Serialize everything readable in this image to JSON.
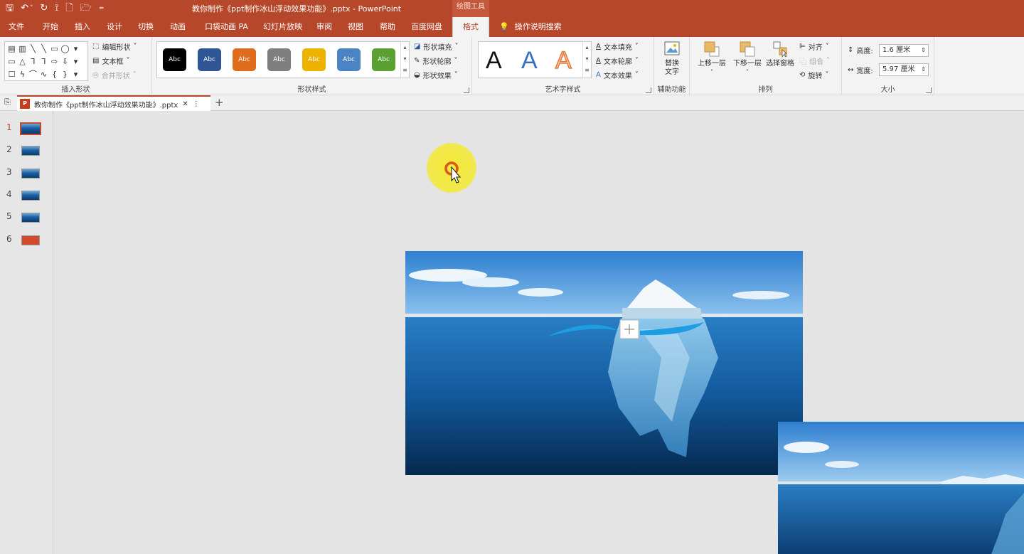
{
  "window": {
    "title": "教你制作《ppt制作冰山浮动效果功能》.pptx  -  PowerPoint",
    "context_tools": "绘图工具"
  },
  "qat": {
    "save": "🖫",
    "undo": "↶",
    "undo_more": "˅",
    "redo": "↻",
    "touch": "⟟",
    "new": "🗋",
    "open": "🗁",
    "customize": "="
  },
  "tabs": [
    "文件",
    "开始",
    "插入",
    "设计",
    "切换",
    "动画",
    "口袋动画 PA",
    "幻灯片放映",
    "审阅",
    "视图",
    "帮助",
    "百度网盘",
    "格式"
  ],
  "active_tab": "格式",
  "tell_me": {
    "icon": "💡",
    "label": "操作说明搜索"
  },
  "ribbon": {
    "insert_shapes": {
      "label": "插入形状",
      "shapes": [
        "▤",
        "▥",
        "╲",
        "╲",
        "▭",
        "◯",
        "▾",
        "▭",
        "△",
        "⅂",
        "⅂",
        "⇨",
        "⇩",
        "▾",
        "☐",
        "ϟ",
        "⌒",
        "∿",
        "{",
        "}",
        "▾"
      ],
      "edit_shape": "编辑形状",
      "text_box": "文本框",
      "merge_shapes": "合并形状"
    },
    "shape_styles": {
      "label": "形状样式",
      "swatch_text": "Abc",
      "swatches": [
        "#000000",
        "#2f5597",
        "#e06c1e",
        "#7f7f7f",
        "#eeb200",
        "#4a84c4",
        "#5aa033"
      ],
      "fill": "形状填充",
      "outline": "形状轮廓",
      "effects": "形状效果"
    },
    "wordart": {
      "label": "艺术字样式",
      "letters": [
        "A",
        "A",
        "A"
      ],
      "text_fill": "文本填充",
      "text_outline": "文本轮廓",
      "text_effects": "文本效果"
    },
    "accessibility": {
      "label": "辅助功能",
      "alt_text_line1": "替换",
      "alt_text_line2": "文字"
    },
    "arrange": {
      "label": "排列",
      "bring_forward": "上移一层",
      "send_backward": "下移一层",
      "selection_pane": "选择窗格",
      "align": "对齐",
      "group": "组合",
      "rotate": "旋转"
    },
    "size": {
      "label": "大小",
      "height_label": "高度:",
      "height_value": "1.6 厘米",
      "width_label": "宽度:",
      "width_value": "5.97 厘米"
    }
  },
  "document_tab": {
    "name": "教你制作《ppt制作冰山浮动效果功能》.pptx",
    "ppt_badge": "P",
    "close": "✕",
    "more": "⋮",
    "add": "+"
  },
  "slides": [
    {
      "num": "1",
      "active": true,
      "kind": "ocean"
    },
    {
      "num": "2",
      "active": false,
      "kind": "ocean"
    },
    {
      "num": "3",
      "active": false,
      "kind": "ocean"
    },
    {
      "num": "4",
      "active": false,
      "kind": "ocean"
    },
    {
      "num": "5",
      "active": false,
      "kind": "ocean"
    },
    {
      "num": "6",
      "active": false,
      "kind": "red"
    }
  ],
  "colors": {
    "accent": "#b7472a",
    "ribbon_bg": "#f3f3f3",
    "canvas_bg": "#e4e4e4",
    "highlight": "#f3ec3a",
    "arc": "#1d9ee2"
  }
}
